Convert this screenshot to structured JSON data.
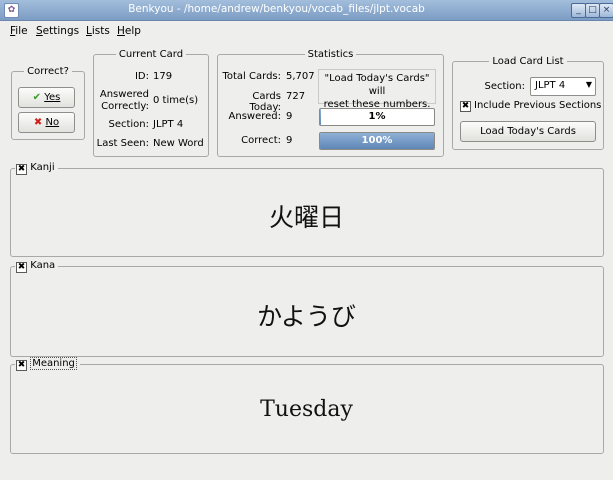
{
  "window": {
    "title": "Benkyou - /home/andrew/benkyou/vocab_files/jlpt.vocab",
    "minimize": "_",
    "maximize": "□",
    "close": "×"
  },
  "menu": {
    "file": "File",
    "settings": "Settings",
    "lists": "Lists",
    "help": "Help"
  },
  "correct_box": {
    "legend": "Correct?",
    "yes_label": "Yes",
    "no_label": "No",
    "yes_icon": "checkmark-icon",
    "no_icon": "red-x-icon"
  },
  "current_card": {
    "legend": "Current Card",
    "id_label": "ID:",
    "id_value": "179",
    "answered_label_1": "Answered",
    "answered_label_2": "Correctly:",
    "answered_value": "0 time(s)",
    "section_label": "Section:",
    "section_value": "JLPT 4",
    "last_seen_label": "Last Seen:",
    "last_seen_value": "New Word"
  },
  "statistics": {
    "legend": "Statistics",
    "total_label": "Total Cards:",
    "total_value": "5,707",
    "today_label": "Cards Today:",
    "today_value": "727",
    "notice_line1": "\"Load Today's Cards\" will",
    "notice_line2": "reset these numbers.",
    "answered_label": "Answered:",
    "answered_value": "9",
    "answered_bar_text": "1%",
    "answered_bar_fraction": 0.01,
    "correct_label": "Correct:",
    "correct_value": "9",
    "correct_bar_text": "100%",
    "correct_bar_fraction": 1.0
  },
  "load_card_list": {
    "legend": "Load Card List",
    "section_label": "Section:",
    "section_value": "JLPT 4",
    "include_label": "Include Previous Sections",
    "include_checked": true,
    "load_button": "Load Today's Cards"
  },
  "panels": {
    "kanji_legend": "Kanji",
    "kanji_text": "火曜日",
    "kana_legend": "Kana",
    "kana_text": "かようび",
    "meaning_legend": "Meaning",
    "meaning_text": "Tuesday"
  },
  "colors": {
    "titlebar": "#8aa8cc",
    "progress_fill": "#6f94c2",
    "no_icon": "#d0211d",
    "yes_icon": "#3a9a2a"
  }
}
